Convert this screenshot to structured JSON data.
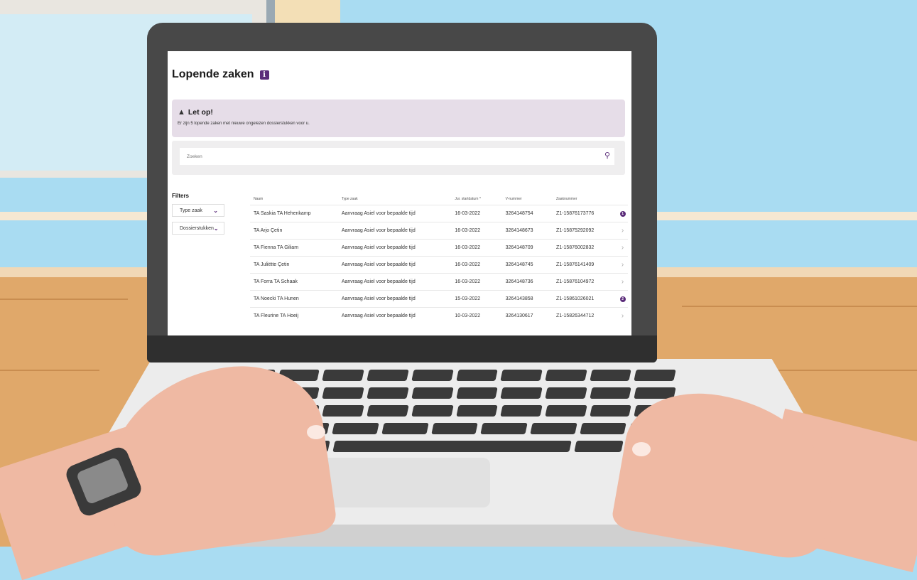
{
  "page": {
    "title": "Lopende zaken",
    "info_icon": "info-icon"
  },
  "alert": {
    "title": "Let op!",
    "text": "Er zijn 5 lopende zaken met nieuwe ongelezen dossierstukken voor u.",
    "icon": "warning-icon"
  },
  "search": {
    "placeholder": "Zoeken",
    "icon": "search-icon"
  },
  "filters": {
    "title": "Filters",
    "items": [
      {
        "label": "Type zaak"
      },
      {
        "label": "Dossierstukken"
      }
    ]
  },
  "table": {
    "headers": [
      "Naam",
      "Type zaak",
      "Jur. startdatum ^",
      "V-nummer",
      "Zaaknummer"
    ],
    "rows": [
      {
        "naam": "TA Saskia TA Hehenkamp",
        "type": "Aanvraag Asiel voor bepaalde tijd",
        "date": "16-03-2022",
        "vnr": "3264148754",
        "znr": "Z1-15876173776",
        "action": "notification",
        "count": "1"
      },
      {
        "naam": "TA Arjo Çetin",
        "type": "Aanvraag Asiel voor bepaalde tijd",
        "date": "16-03-2022",
        "vnr": "3264148673",
        "znr": "Z1-15875292092",
        "action": "arrow"
      },
      {
        "naam": "TA Fienna TA Giliam",
        "type": "Aanvraag Asiel voor bepaalde tijd",
        "date": "16-03-2022",
        "vnr": "3264148709",
        "znr": "Z1-15876002832",
        "action": "arrow"
      },
      {
        "naam": "TA Juliëtte Çetin",
        "type": "Aanvraag Asiel voor bepaalde tijd",
        "date": "16-03-2022",
        "vnr": "3264148745",
        "znr": "Z1-15876141409",
        "action": "arrow"
      },
      {
        "naam": "TA Forra TA Schaak",
        "type": "Aanvraag Asiel voor bepaalde tijd",
        "date": "16-03-2022",
        "vnr": "3264148736",
        "znr": "Z1-15876104972",
        "action": "arrow"
      },
      {
        "naam": "TA Noecki TA Hunen",
        "type": "Aanvraag Asiel voor bepaalde tijd",
        "date": "15-03-2022",
        "vnr": "3264143858",
        "znr": "Z1-15861026021",
        "action": "notification",
        "count": "2"
      },
      {
        "naam": "TA Fleurine TA Hoeij",
        "type": "Aanvraag Asiel voor bepaalde tijd",
        "date": "10-03-2022",
        "vnr": "3264130617",
        "znr": "Z1-15826344712",
        "action": "arrow"
      }
    ]
  },
  "colors": {
    "accent": "#5b2c7a",
    "alert_bg": "#e6dde8",
    "wall": "#a9dcf2",
    "desk": "#e0a86a"
  }
}
